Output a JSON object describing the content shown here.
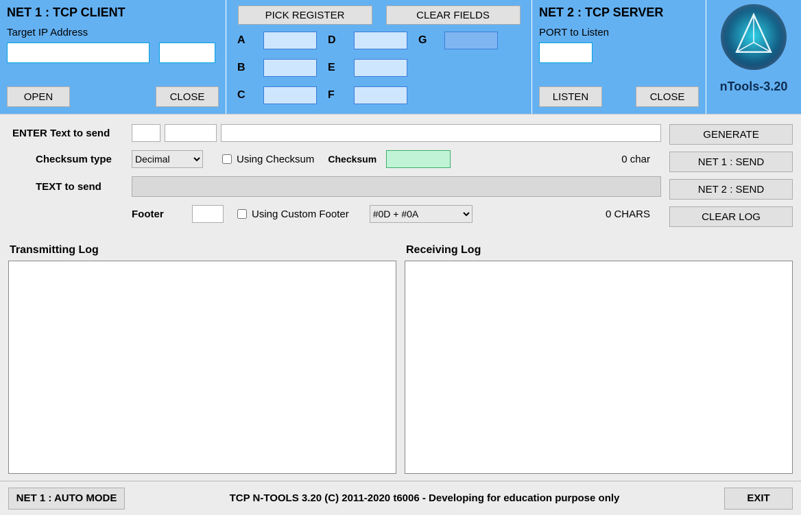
{
  "net1": {
    "title": "NET 1 : TCP CLIENT",
    "target_label": "Target IP Address",
    "ip_value": "",
    "port_value": "",
    "open_btn": "OPEN",
    "close_btn": "CLOSE"
  },
  "registers": {
    "pick_btn": "PICK REGISTER",
    "clear_btn": "CLEAR FIELDS",
    "labels": {
      "a": "A",
      "b": "B",
      "c": "C",
      "d": "D",
      "e": "E",
      "f": "F",
      "g": "G"
    }
  },
  "net2": {
    "title": "NET 2 : TCP SERVER",
    "port_label": "PORT to Listen",
    "port_value": "",
    "listen_btn": "LISTEN",
    "close_btn": "CLOSE"
  },
  "brand": {
    "name": "nTools-3.20"
  },
  "send": {
    "enter_label": "ENTER Text to send",
    "a_value": "",
    "b_value": "",
    "long_value": "",
    "checksum_type_label": "Checksum type",
    "checksum_type_value": "Decimal",
    "using_checksum_label": "Using Checksum",
    "checksum_label": "Checksum",
    "checksum_value": "",
    "char_count": "0 char",
    "text_to_send_label": "TEXT to send",
    "footer_label": "Footer",
    "footer_value": "",
    "using_footer_label": "Using Custom Footer",
    "footer_select_value": "#0D + #0A",
    "chars_count": "0 CHARS"
  },
  "buttons": {
    "generate": "GENERATE",
    "net1_send": "NET 1 : SEND",
    "net2_send": "NET 2 : SEND",
    "clear_log": "CLEAR LOG"
  },
  "logs": {
    "tx_title": "Transmitting Log",
    "rx_title": "Receiving Log"
  },
  "footer": {
    "mode_btn": "NET 1 : AUTO MODE",
    "center": "TCP N-TOOLS 3.20 (C) 2011-2020 t6006 - Developing for education purpose only",
    "exit_btn": "EXIT"
  }
}
